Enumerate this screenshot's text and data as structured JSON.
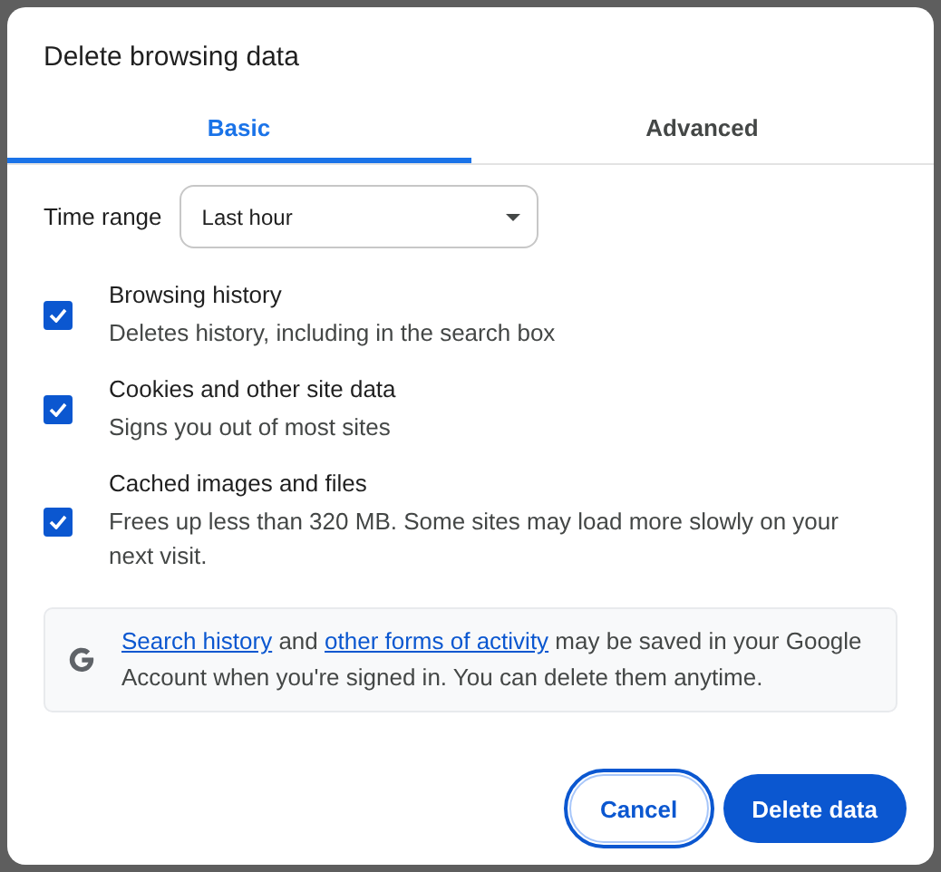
{
  "dialog": {
    "title": "Delete browsing data"
  },
  "tabs": [
    {
      "label": "Basic",
      "selected": true
    },
    {
      "label": "Advanced",
      "selected": false
    }
  ],
  "time_range": {
    "label": "Time range",
    "value": "Last hour"
  },
  "options": [
    {
      "title": "Browsing history",
      "description": "Deletes history, including in the search box",
      "checked": true
    },
    {
      "title": "Cookies and other site data",
      "description": "Signs you out of most sites",
      "checked": true
    },
    {
      "title": "Cached images and files",
      "description": "Frees up less than 320 MB. Some sites may load more slowly on your next visit.",
      "checked": true
    }
  ],
  "info": {
    "parts": [
      {
        "kind": "link",
        "text": "Search history"
      },
      {
        "kind": "text",
        "text": " and "
      },
      {
        "kind": "link",
        "text": "other forms of activity"
      },
      {
        "kind": "text",
        "text": " may be saved in your Google Account when you're signed in. You can delete them anytime."
      }
    ]
  },
  "buttons": [
    {
      "label": "Cancel",
      "kind": "secondary",
      "focused": true
    },
    {
      "label": "Delete data",
      "kind": "primary",
      "focused": false
    }
  ]
}
